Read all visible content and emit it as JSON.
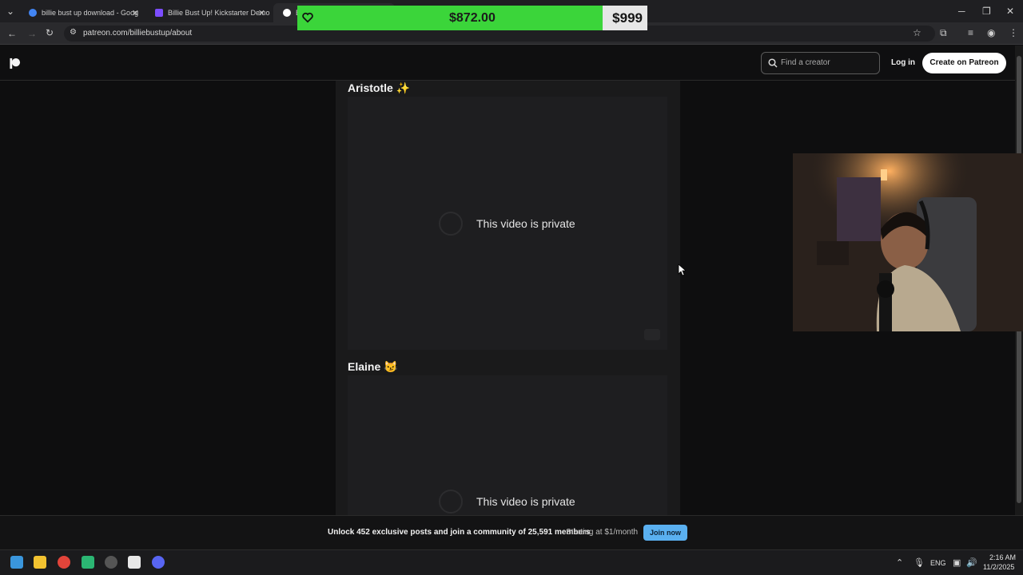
{
  "browser": {
    "tabs": [
      {
        "label": "billie bust up download - Goog",
        "favicon_color": "#4285f4"
      },
      {
        "label": "Billie Bust Up! Kickstarter Demo",
        "favicon_color": "#7c4dff"
      },
      {
        "label": "B",
        "favicon_color": "#ffffff"
      }
    ],
    "url": "patreon.com/billiebustup/about"
  },
  "donation": {
    "amount": "$872.00",
    "goal": "$999",
    "progress": 0.873,
    "fill_color": "#3bd53a"
  },
  "header": {
    "search_placeholder": "Find a creator",
    "login_label": "Log in",
    "create_label": "Create on Patreon"
  },
  "videos": [
    {
      "title": "Aristotle ✨",
      "status": "This video is private"
    },
    {
      "title": "Elaine 😼",
      "status": "This video is private"
    }
  ],
  "banner": {
    "text": "Unlock 452 exclusive posts and join a community of 25,591 members",
    "price": "Starting at $1/month",
    "join_label": "Join now"
  },
  "taskbar": {
    "lang": "ENG",
    "time": "2:16 AM",
    "date": "11/2/2025"
  },
  "icons": {
    "back": "back-arrow-icon",
    "forward": "forward-arrow-icon",
    "reload": "reload-icon",
    "star": "bookmark-star-icon",
    "extensions": "extensions-icon",
    "profile": "profile-icon",
    "search": "search-icon"
  }
}
